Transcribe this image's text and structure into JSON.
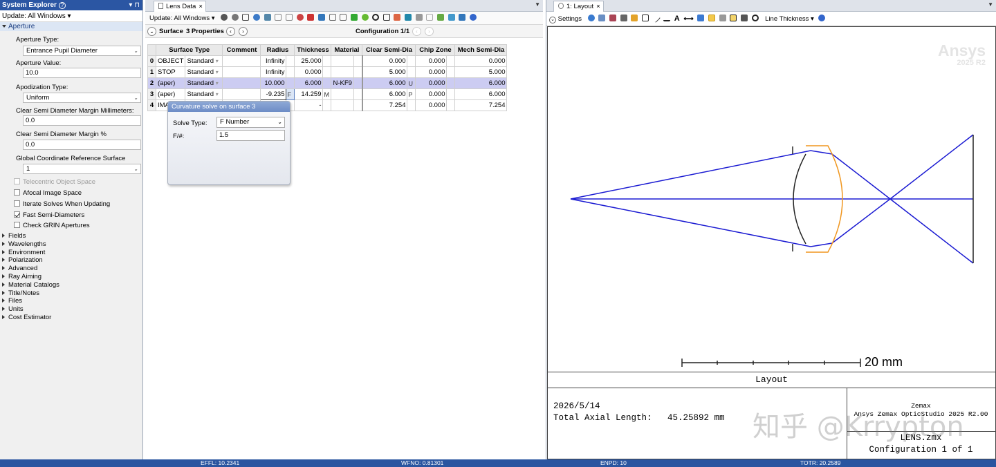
{
  "system_explorer": {
    "title": "System Explorer",
    "pin": "▾ ⊓",
    "update": "Update: All Windows ▾",
    "section_aperture": "Aperture",
    "aperture_type_label": "Aperture Type:",
    "aperture_type_value": "Entrance Pupil Diameter",
    "aperture_value_label": "Aperture Value:",
    "aperture_value": "10.0",
    "apodization_label": "Apodization Type:",
    "apodization_value": "Uniform",
    "csd_mm_label": "Clear Semi Diameter Margin Millimeters:",
    "csd_mm_value": "0.0",
    "csd_pct_label": "Clear Semi Diameter Margin %",
    "csd_pct_value": "0.0",
    "gcrs_label": "Global Coordinate Reference Surface",
    "gcrs_value": "1",
    "checkboxes": [
      {
        "label": "Telecentric Object Space",
        "checked": false,
        "disabled": true
      },
      {
        "label": "Afocal Image Space",
        "checked": false,
        "disabled": false
      },
      {
        "label": "Iterate Solves When Updating",
        "checked": false,
        "disabled": false
      },
      {
        "label": "Fast Semi-Diameters",
        "checked": true,
        "disabled": false
      },
      {
        "label": "Check GRIN Apertures",
        "checked": false,
        "disabled": false
      }
    ],
    "tree": [
      "Fields",
      "Wavelengths",
      "Environment",
      "Polarization",
      "Advanced",
      "Ray Aiming",
      "Material Catalogs",
      "Title/Notes",
      "Files",
      "Units",
      "Cost Estimator"
    ]
  },
  "lens_data": {
    "tab": "Lens Data",
    "update": "Update: All Windows ▾",
    "surface_label": "Surface",
    "properties_label": "3 Properties",
    "configuration": "Configuration 1/1",
    "headers": [
      "",
      "Surface Type",
      "",
      "Comment",
      "Radius",
      "",
      "Thickness",
      "",
      "Material",
      "",
      "Clear Semi-Dia",
      "",
      "Chip Zone",
      "",
      "Mech Semi-Dia"
    ],
    "rows": [
      {
        "idx": "0",
        "name": "OBJECT",
        "type": "Standard",
        "radius": "Infinity",
        "r_solve": "",
        "thick": "25.000",
        "t_solve": "",
        "mat": "",
        "csd": "0.000",
        "csd_solve": "",
        "chip": "0.000",
        "mech": "0.000"
      },
      {
        "idx": "1",
        "name": "STOP",
        "type": "Standard",
        "radius": "Infinity",
        "r_solve": "",
        "thick": "0.000",
        "t_solve": "",
        "mat": "",
        "csd": "5.000",
        "csd_solve": "",
        "chip": "0.000",
        "mech": "5.000"
      },
      {
        "idx": "2",
        "name": "(aper)",
        "type": "Standard",
        "radius": "10.000",
        "r_solve": "",
        "thick": "6.000",
        "t_solve": "",
        "mat": "N-KF9",
        "csd": "6.000",
        "csd_solve": "U",
        "chip": "0.000",
        "mech": "6.000"
      },
      {
        "idx": "3",
        "name": "(aper)",
        "type": "Standard",
        "radius": "-9.235",
        "r_solve": "F",
        "thick": "14.259",
        "t_solve": "M",
        "mat": "",
        "csd": "6.000",
        "csd_solve": "P",
        "chip": "0.000",
        "mech": "6.000"
      },
      {
        "idx": "4",
        "name": "IMA",
        "type": "",
        "radius": "",
        "r_solve": "",
        "thick": "-",
        "t_solve": "",
        "mat": "",
        "csd": "7.254",
        "csd_solve": "",
        "chip": "0.000",
        "mech": "7.254"
      }
    ],
    "popup": {
      "title": "Curvature solve on surface 3",
      "solve_type_label": "Solve Type:",
      "solve_type_value": "F Number",
      "fnum_label": "F/#:",
      "fnum_value": "1.5"
    }
  },
  "layout": {
    "tab": "1: Layout",
    "settings": "Settings",
    "line_thickness": "Line Thickness ▾",
    "watermark_brand": "Ansys",
    "watermark_version": "2025 R2",
    "scale_label": "20 mm",
    "title": "Layout",
    "date": "2026/5/14",
    "total_axial_label": "Total Axial Length:",
    "total_axial_value": "45.25892 mm",
    "company": "Zemax",
    "product": "Ansys Zemax OpticStudio 2025 R2.00",
    "file": "LENS.zmx",
    "config": "Configuration 1 of 1",
    "overlay_watermark": "知乎 @Krrypton",
    "colors": {
      "ray": "#1a1ad2",
      "lens_front": "#222222",
      "lens_back": "#f0961e"
    }
  },
  "status_bar": {
    "effl": "EFFL: 10.2341",
    "wfno": "WFNO: 0.81301",
    "enpd": "ENPD: 10",
    "totr": "TOTR: 20.2589"
  }
}
